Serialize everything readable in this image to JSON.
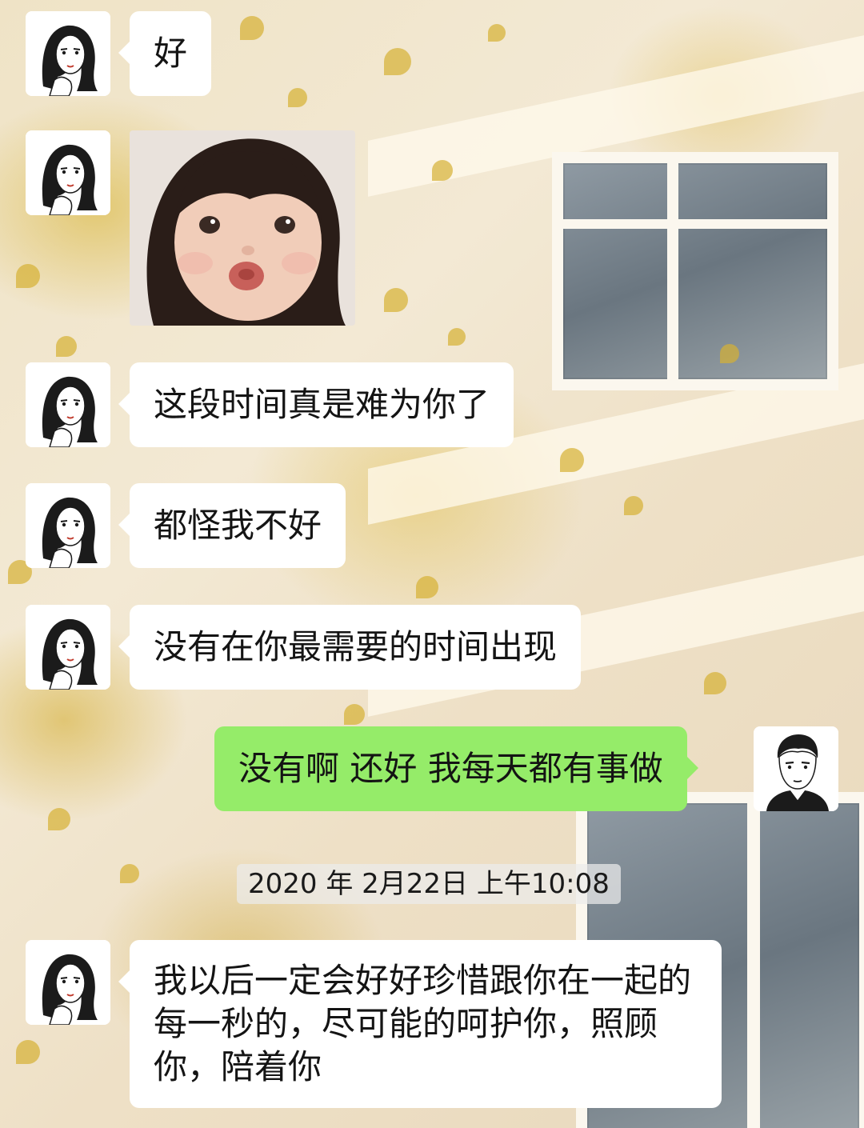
{
  "messages": [
    {
      "side": "left",
      "type": "text",
      "text": "好"
    },
    {
      "side": "left",
      "type": "sticker",
      "sticker_icon": "pouting-girl-sticker"
    },
    {
      "side": "left",
      "type": "text",
      "text": "这段时间真是难为你了"
    },
    {
      "side": "left",
      "type": "text",
      "text": "都怪我不好"
    },
    {
      "side": "left",
      "type": "text",
      "text": "没有在你最需要的时间出现"
    },
    {
      "side": "right",
      "type": "text",
      "text": "没有啊 还好 我每天都有事做"
    },
    {
      "side": "left",
      "type": "text",
      "text": "我以后一定会好好珍惜跟你在一起的每一秒的，尽可能的呵护你，照顾你，陪着你"
    }
  ],
  "timestamp": "2020 年 2月22日 上午10:08",
  "avatars": {
    "contact": "girl-sketch-avatar",
    "self": "boy-sketch-avatar"
  },
  "colors": {
    "self_bubble": "#95ec69",
    "contact_bubble": "#ffffff",
    "timestamp_bg": "#ebebeb"
  }
}
